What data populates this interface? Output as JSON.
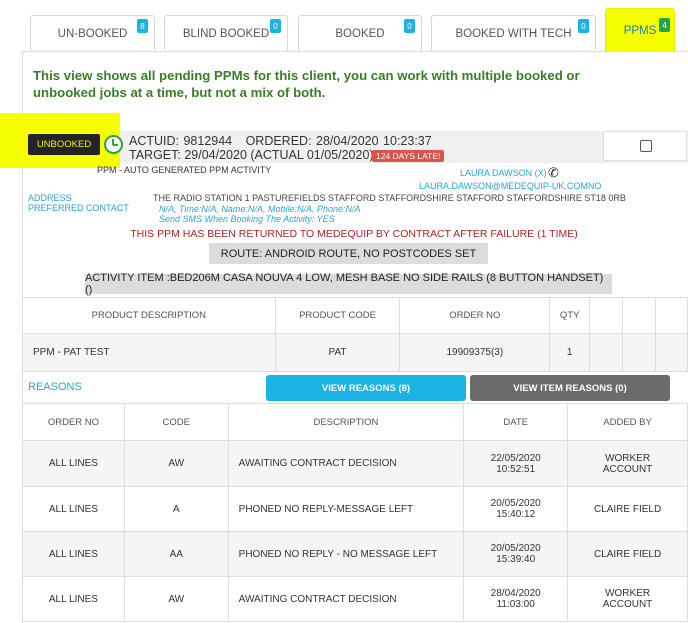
{
  "tabs": [
    {
      "label": "UN-BOOKED",
      "count": "8"
    },
    {
      "label": "BLIND BOOKED",
      "count": "0"
    },
    {
      "label": "BOOKED",
      "count": "0"
    },
    {
      "label": "BOOKED WITH TECH",
      "count": "0"
    },
    {
      "label": "PPMS",
      "count": "4"
    }
  ],
  "info_text": "This view shows all pending PPMs for this client, you can work with multiple booked or unbooked jobs at a time, but not a mix of both.",
  "job": {
    "status": "UNBOOKED",
    "actuid": "ACTUID: 9812944",
    "ordered": "ORDERED: 28/04/2020 10:23:37",
    "target": "TARGET: 29/04/2020 (ACTUAL 01/05/2020)",
    "late_badge": "124 DAYS LATE!",
    "activity_type": "PPM - AUTO GENERATED PPM ACTIVITY",
    "contact_name": "LAURA DAWSON (X)",
    "contact_email": "LAURA.DAWSON@MEDEQUIP-UK.COMNO",
    "address_label": "ADDRESS",
    "preferred_contact_label": "PREFERRED CONTACT",
    "address": "THE RADIO STATION 1 PASTUREFIELDS STAFFORD STAFFORDSHIRE STAFFORD STAFFORDSHIRE ST18 0RB",
    "preferred_contact": "N/A, Time:N/A, Name:N/A, Mobile:N/A, Phone:N/A",
    "sms_text": "Send SMS When Booking The Activity: YES",
    "returned_text": "THIS PPM HAS BEEN RETURNED TO MEDEQUIP BY CONTRACT AFTER FAILURE (1 TIME)",
    "route": "ROUTE: ANDROID ROUTE, NO POSTCODES SET",
    "activity_item": "ACTIVITY ITEM :BED206M CASA NOUVA 4 LOW, MESH BASE NO SIDE RAILS (8 BUTTON HANDSET) ()"
  },
  "products": {
    "headers": [
      "PRODUCT DESCRIPTION",
      "PRODUCT CODE",
      "ORDER NO",
      "QTY"
    ],
    "rows": [
      {
        "description": "PPM - PAT TEST",
        "code": "PAT",
        "order_no": "19909375(3)",
        "qty": "1"
      }
    ]
  },
  "reasons": {
    "label": "REASONS",
    "view_reasons_button": "VIEW REASONS (8)",
    "view_item_reasons_button": "VIEW ITEM REASONS (0)",
    "headers": [
      "ORDER NO",
      "CODE",
      "DESCRIPTION",
      "DATE",
      "ADDED BY"
    ],
    "rows": [
      {
        "order_no": "ALL LINES",
        "code": "AW",
        "description": "AWAITING CONTRACT DECISION",
        "date": "22/05/2020",
        "time": "10:52:51",
        "added_by_1": "WORKER",
        "added_by_2": "ACCOUNT"
      },
      {
        "order_no": "ALL LINES",
        "code": "A",
        "description": "PHONED NO REPLY-MESSAGE LEFT",
        "date": "20/05/2020",
        "time": "15:40:12",
        "added_by_1": "CLAIRE FIELD",
        "added_by_2": ""
      },
      {
        "order_no": "ALL LINES",
        "code": "AA",
        "description": "PHONED NO REPLY - NO MESSAGE LEFT",
        "date": "20/05/2020",
        "time": "15:39:40",
        "added_by_1": "CLAIRE FIELD",
        "added_by_2": ""
      },
      {
        "order_no": "ALL LINES",
        "code": "AW",
        "description": "AWAITING CONTRACT DECISION",
        "date": "28/04/2020",
        "time": "11:03:00",
        "added_by_1": "WORKER",
        "added_by_2": "ACCOUNT"
      }
    ]
  },
  "colors": {
    "highlight": "#f5ff00",
    "accent": "#1ab3e3",
    "late": "#d9534f",
    "success": "#22a84a"
  }
}
